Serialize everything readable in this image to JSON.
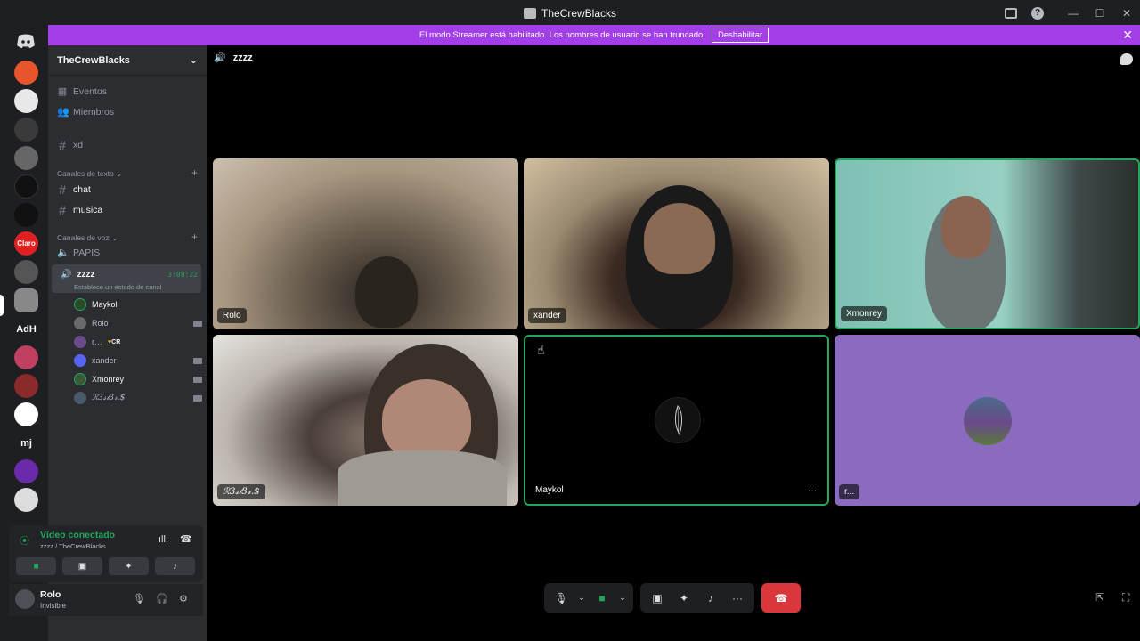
{
  "window": {
    "title": "TheCrewBlacks"
  },
  "banner": {
    "text": "El modo Streamer está habilitado. Los nombres de usuario se han truncado.",
    "button": "Deshabilitar"
  },
  "rail": {
    "servers": [
      "Claro",
      "AdH",
      "mj"
    ]
  },
  "sidebar": {
    "server_name": "TheCrewBlacks",
    "events": "Eventos",
    "members": "Miembros",
    "channel_xd": "xd",
    "text_category": "Canales de texto",
    "text_channels": [
      "chat",
      "musica"
    ],
    "voice_category": "Canales de voz",
    "voice_channels": [
      "PAPIS",
      "zzzz"
    ],
    "active_time": "3:09:22",
    "active_status": "Establece un estado de canal",
    "voice_members": [
      {
        "name": "Maykol",
        "camera": false
      },
      {
        "name": "Rolo",
        "camera": true
      },
      {
        "name": "r…",
        "tag": "CR",
        "camera": false
      },
      {
        "name": "xander",
        "camera": true
      },
      {
        "name": "Xmonrey",
        "camera": true
      },
      {
        "name": "ℛ3𝓈𝓉3𝓇.$",
        "camera": true
      }
    ]
  },
  "voice_panel": {
    "title": "Vídeo conectado",
    "subtitle": "zzzz / TheCrewBlacks"
  },
  "user_panel": {
    "name": "Rolo",
    "status": "Invisible"
  },
  "main": {
    "channel": "zzzz"
  },
  "tiles": [
    {
      "name": "Rolo"
    },
    {
      "name": "xander"
    },
    {
      "name": "Xmonrey"
    },
    {
      "name": "ℛ3𝓈𝓉3𝓇.$"
    },
    {
      "name": "Maykol",
      "more": "···"
    },
    {
      "name": "r..."
    }
  ],
  "colors": {
    "accent": "#a33ee8",
    "connected": "#23a55a",
    "hangup": "#da373c",
    "tile_purple": "#8a6bbf"
  }
}
